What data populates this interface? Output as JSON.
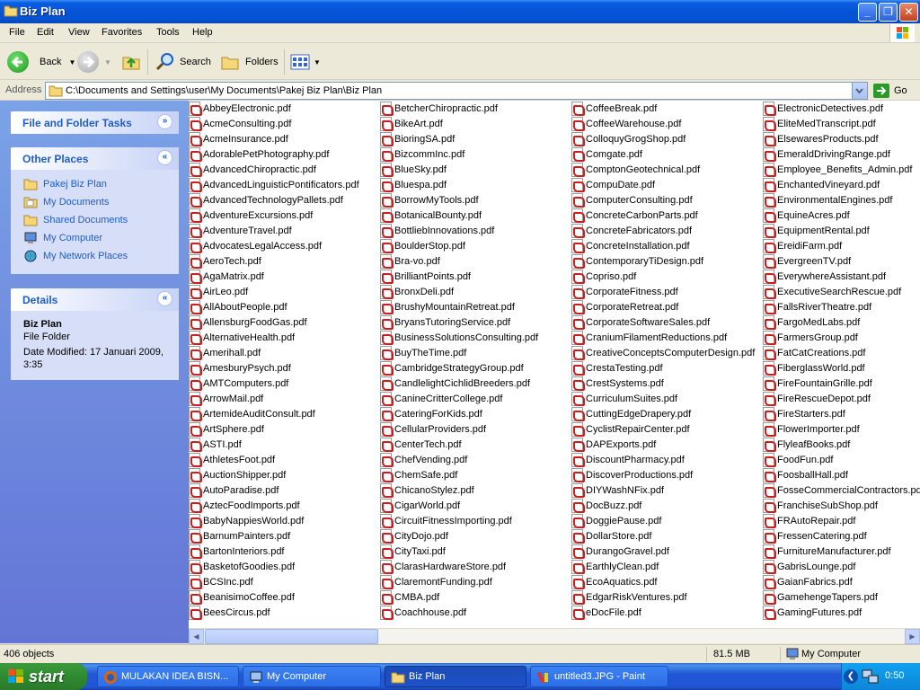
{
  "window": {
    "title": "Biz Plan"
  },
  "menu": [
    "File",
    "Edit",
    "View",
    "Favorites",
    "Tools",
    "Help"
  ],
  "toolbar": {
    "back": "Back",
    "search": "Search",
    "folders": "Folders"
  },
  "address": {
    "label": "Address",
    "path": "C:\\Documents and Settings\\user\\My Documents\\Pakej Biz Plan\\Biz Plan",
    "go": "Go"
  },
  "left": {
    "tasks_title": "File and Folder Tasks",
    "places_title": "Other Places",
    "places": [
      "Pakej Biz Plan",
      "My Documents",
      "Shared Documents",
      "My Computer",
      "My Network Places"
    ],
    "details_title": "Details",
    "details_name": "Biz Plan",
    "details_type": "File Folder",
    "details_modified": "Date Modified: 17 Januari 2009, 3:35"
  },
  "files": [
    [
      "AbbeyElectronic.pdf",
      "AcmeConsulting.pdf",
      "AcmeInsurance.pdf",
      "AdorablePetPhotography.pdf",
      "AdvancedChiropractic.pdf",
      "AdvancedLinguisticPontificators.pdf",
      "AdvancedTechnologyPallets.pdf",
      "AdventureExcursions.pdf",
      "AdventureTravel.pdf",
      "AdvocatesLegalAccess.pdf",
      "AeroTech.pdf",
      "AgaMatrix.pdf",
      "AirLeo.pdf",
      "AllAboutPeople.pdf",
      "AllensburgFoodGas.pdf",
      "AlternativeHealth.pdf",
      "Amerihall.pdf",
      "AmesburyPsych.pdf",
      "AMTComputers.pdf",
      "ArrowMail.pdf",
      "ArtemideAuditConsult.pdf",
      "ArtSphere.pdf",
      "ASTI.pdf",
      "AthletesFoot.pdf",
      "AuctionShipper.pdf",
      "AutoParadise.pdf",
      "AztecFoodImports.pdf",
      "BabyNappiesWorld.pdf",
      "BarnumPainters.pdf",
      "BartonInteriors.pdf",
      "BasketofGoodies.pdf",
      "BCSInc.pdf",
      "BeanisimoCoffee.pdf",
      "BeesCircus.pdf"
    ],
    [
      "BetcherChiropractic.pdf",
      "BikeArt.pdf",
      "BioringSA.pdf",
      "BizcommInc.pdf",
      "BlueSky.pdf",
      "Bluespa.pdf",
      "BorrowMyTools.pdf",
      "BotanicalBounty.pdf",
      "BottliebInnovations.pdf",
      "BoulderStop.pdf",
      "Bra-vo.pdf",
      "BrilliantPoints.pdf",
      "BronxDeli.pdf",
      "BrushyMountainRetreat.pdf",
      "BryansTutoringService.pdf",
      "BusinessSolutionsConsulting.pdf",
      "BuyTheTime.pdf",
      "CambridgeStrategyGroup.pdf",
      "CandlelightCichlidBreeders.pdf",
      "CanineCritterCollege.pdf",
      "CateringForKids.pdf",
      "CellularProviders.pdf",
      "CenterTech.pdf",
      "ChefVending.pdf",
      "ChemSafe.pdf",
      "ChicanoStylez.pdf",
      "CigarWorld.pdf",
      "CircuitFitnessImporting.pdf",
      "CityDojo.pdf",
      "CityTaxi.pdf",
      "ClarasHardwareStore.pdf",
      "ClaremontFunding.pdf",
      "CMBA.pdf",
      "Coachhouse.pdf"
    ],
    [
      "CoffeeBreak.pdf",
      "CoffeeWarehouse.pdf",
      "ColloquyGrogShop.pdf",
      "Comgate.pdf",
      "ComptonGeotechnical.pdf",
      "CompuDate.pdf",
      "ComputerConsulting.pdf",
      "ConcreteCarbonParts.pdf",
      "ConcreteFabricators.pdf",
      "ConcreteInstallation.pdf",
      "ContemporaryTiDesign.pdf",
      "Copriso.pdf",
      "CorporateFitness.pdf",
      "CorporateRetreat.pdf",
      "CorporateSoftwareSales.pdf",
      "CraniumFilamentReductions.pdf",
      "CreativeConceptsComputerDesign.pdf",
      "CrestaTesting.pdf",
      "CrestSystems.pdf",
      "CurriculumSuites.pdf",
      "CuttingEdgeDrapery.pdf",
      "CyclistRepairCenter.pdf",
      "DAPExports.pdf",
      "DiscountPharmacy.pdf",
      "DiscoverProductions.pdf",
      "DIYWashNFix.pdf",
      "DocBuzz.pdf",
      "DoggiePause.pdf",
      "DollarStore.pdf",
      "DurangoGravel.pdf",
      "EarthlyClean.pdf",
      "EcoAquatics.pdf",
      "EdgarRiskVentures.pdf",
      "eDocFile.pdf"
    ],
    [
      "ElectronicDetectives.pdf",
      "EliteMedTranscript.pdf",
      "ElsewaresProducts.pdf",
      "EmeraldDrivingRange.pdf",
      "Employee_Benefits_Admin.pdf",
      "EnchantedVineyard.pdf",
      "EnvironmentalEngines.pdf",
      "EquineAcres.pdf",
      "EquipmentRental.pdf",
      "EreidiFarm.pdf",
      "EvergreenTV.pdf",
      "EverywhereAssistant.pdf",
      "ExecutiveSearchRescue.pdf",
      "FallsRiverTheatre.pdf",
      "FargoMedLabs.pdf",
      "FarmersGroup.pdf",
      "FatCatCreations.pdf",
      "FiberglassWorld.pdf",
      "FireFountainGrille.pdf",
      "FireRescueDepot.pdf",
      "FireStarters.pdf",
      "FlowerImporter.pdf",
      "FlyleafBooks.pdf",
      "FoodFun.pdf",
      "FoosballHall.pdf",
      "FosseCommercialContractors.pdf",
      "FranchiseSubShop.pdf",
      "FRAutoRepair.pdf",
      "FressenCatering.pdf",
      "FurnitureManufacturer.pdf",
      "GabrisLounge.pdf",
      "GaianFabrics.pdf",
      "GamehengeTapers.pdf",
      "GamingFutures.pdf"
    ]
  ],
  "status": {
    "objects": "406 objects",
    "size": "81.5 MB",
    "location": "My Computer"
  },
  "taskbar": {
    "start": "start",
    "tasks": [
      "MULAKAN IDEA BISN...",
      "My Computer",
      "Biz Plan",
      "untitled3.JPG - Paint"
    ],
    "clock": "0:50"
  },
  "colors": {
    "link": "#215dc6",
    "title_blue": "#0553d6",
    "start_green": "#2f8b2f"
  }
}
